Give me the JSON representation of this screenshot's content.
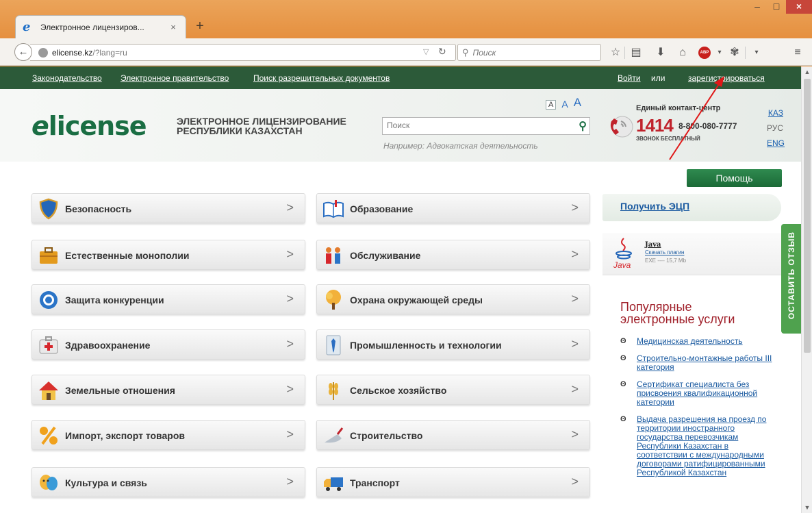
{
  "browser": {
    "tab_title": "Электронное лицензиров...",
    "tab_close": "×",
    "new_tab": "+",
    "url_host": "elicense.kz",
    "url_path": "/?lang=ru",
    "search_placeholder": "Поиск",
    "window_min": "–",
    "window_max": "□",
    "window_close": "×"
  },
  "topbar": {
    "links": [
      "Законодательство",
      "Электронное правительство",
      "Поиск разрешительных документов"
    ],
    "login": "Войти",
    "or": "или",
    "register": "зарегистрироваться"
  },
  "header": {
    "logo_e": "e",
    "logo_text": "license",
    "title_line1": "ЭЛЕКТРОННОЕ ЛИЦЕНЗИРОВАНИЕ",
    "title_line2": "РЕСПУБЛИКИ КАЗАХСТАН",
    "font_sizes": [
      "A",
      "A",
      "A"
    ],
    "search_placeholder": "Поиск",
    "search_hint": "Например: Адвокатская деятельность",
    "contact_label": "Единый контакт-центр",
    "contact_short": "1414",
    "contact_long": "8-800-080-7777",
    "contact_free": "ЗВОНОК БЕСПЛАТНЫЙ",
    "langs": [
      "КАЗ",
      "РУС",
      "ENG"
    ]
  },
  "help_label": "Помощь",
  "categories_left": [
    {
      "label": "Безопасность",
      "icon": "shield-icon"
    },
    {
      "label": "Естественные монополии",
      "icon": "briefcase-icon"
    },
    {
      "label": "Защита конкуренции",
      "icon": "target-icon"
    },
    {
      "label": "Здравоохранение",
      "icon": "medkit-icon"
    },
    {
      "label": "Земельные отношения",
      "icon": "house-icon"
    },
    {
      "label": "Импорт, экспорт товаров",
      "icon": "percent-icon"
    },
    {
      "label": "Культура и связь",
      "icon": "theater-masks-icon"
    }
  ],
  "categories_right": [
    {
      "label": "Образование",
      "icon": "book-icon"
    },
    {
      "label": "Обслуживание",
      "icon": "people-icon"
    },
    {
      "label": "Охрана окружающей среды",
      "icon": "tree-icon"
    },
    {
      "label": "Промышленность и технологии",
      "icon": "tie-icon"
    },
    {
      "label": "Сельское хозяйство",
      "icon": "wheat-icon"
    },
    {
      "label": "Строительство",
      "icon": "trowel-icon"
    },
    {
      "label": "Транспорт",
      "icon": "truck-icon"
    }
  ],
  "category_arrow": ">",
  "ecp_link": "Получить ЭЦП",
  "java": {
    "name": "Java",
    "download": "Скачать плагин",
    "meta": "EXE ---- 15,7 Mb",
    "logo_text": "Java"
  },
  "feedback_label": "ОСТАВИТЬ ОТЗЫВ",
  "popular": {
    "title_line1": "Популярные",
    "title_line2": "электронные услуги",
    "items": [
      "Медицинская деятельность",
      "Строительно-монтажные работы III категория",
      "Сертификат специалиста без присвоения квалификационной категории",
      "Выдача разрешения на проезд по территории иностранного государства перевозчикам Республики Казахстан в соответствии с международными договорами ратифицированными Республикой Казахстан"
    ]
  },
  "colors": {
    "topbar": "#2c5a39",
    "brand_green": "#1a6e43",
    "accent_red": "#c0232c",
    "link_blue": "#1a5aa0",
    "feedback_green": "#4fa24e",
    "titlebar_orange": "#e58f3e"
  }
}
